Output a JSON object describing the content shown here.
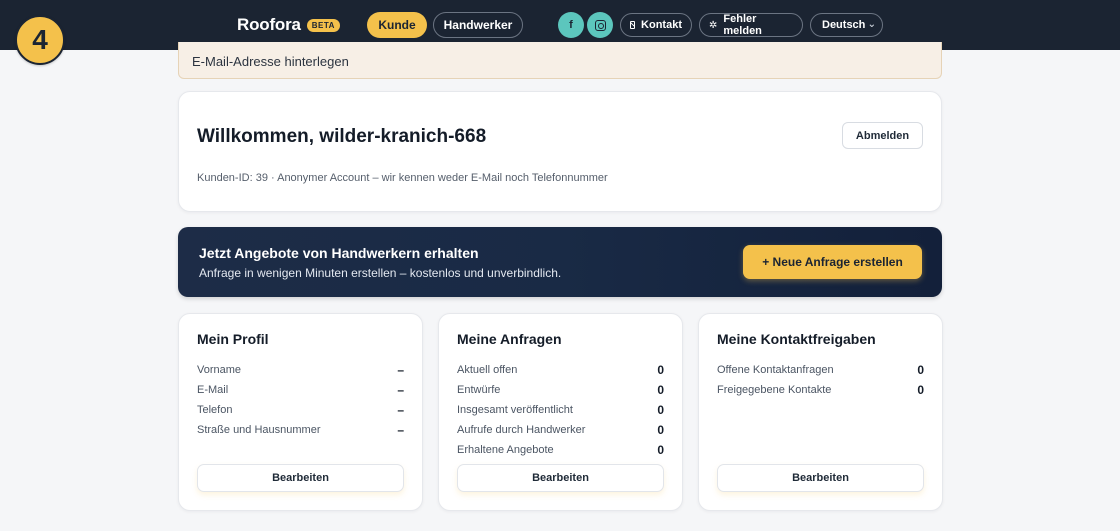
{
  "step_badge": "4",
  "nav": {
    "brand": "Roofora",
    "beta": "BETA",
    "kunde": "Kunde",
    "handwerker": "Handwerker",
    "facebook": "f",
    "kontakt": "Kontakt",
    "fehler": "Fehler melden",
    "language": "Deutsch"
  },
  "notice": "E-Mail-Adresse hinterlegen",
  "welcome": {
    "title": "Willkommen, wilder-kranich-668",
    "logout": "Abmelden",
    "meta": "Kunden-ID: 39 · Anonymer Account – wir kennen weder E-Mail noch Telefonnummer"
  },
  "cta": {
    "title": "Jetzt Angebote von Handwerkern erhalten",
    "subtitle": "Anfrage in wenigen Minuten erstellen – kostenlos und unverbindlich.",
    "button": "+ Neue Anfrage erstellen"
  },
  "profil": {
    "title": "Mein Profil",
    "rows": [
      {
        "label": "Vorname",
        "value": "–"
      },
      {
        "label": "E-Mail",
        "value": "–"
      },
      {
        "label": "Telefon",
        "value": "–"
      },
      {
        "label": "Straße und Hausnummer",
        "value": "–"
      }
    ],
    "button": "Bearbeiten"
  },
  "anfragen": {
    "title": "Meine Anfragen",
    "rows": [
      {
        "label": "Aktuell offen",
        "value": "0"
      },
      {
        "label": "Entwürfe",
        "value": "0"
      },
      {
        "label": "Insgesamt veröffentlicht",
        "value": "0"
      },
      {
        "label": "Aufrufe durch Handwerker",
        "value": "0"
      },
      {
        "label": "Erhaltene Angebote",
        "value": "0"
      }
    ],
    "button": "Bearbeiten"
  },
  "kontakt": {
    "title": "Meine Kontaktfreigaben",
    "rows": [
      {
        "label": "Offene Kontaktanfragen",
        "value": "0"
      },
      {
        "label": "Freigegebene Kontakte",
        "value": "0"
      }
    ],
    "button": "Bearbeiten"
  },
  "colors": {
    "nav_bg": "#1b2432",
    "accent": "#f4c14b",
    "social": "#5cc6bd"
  }
}
